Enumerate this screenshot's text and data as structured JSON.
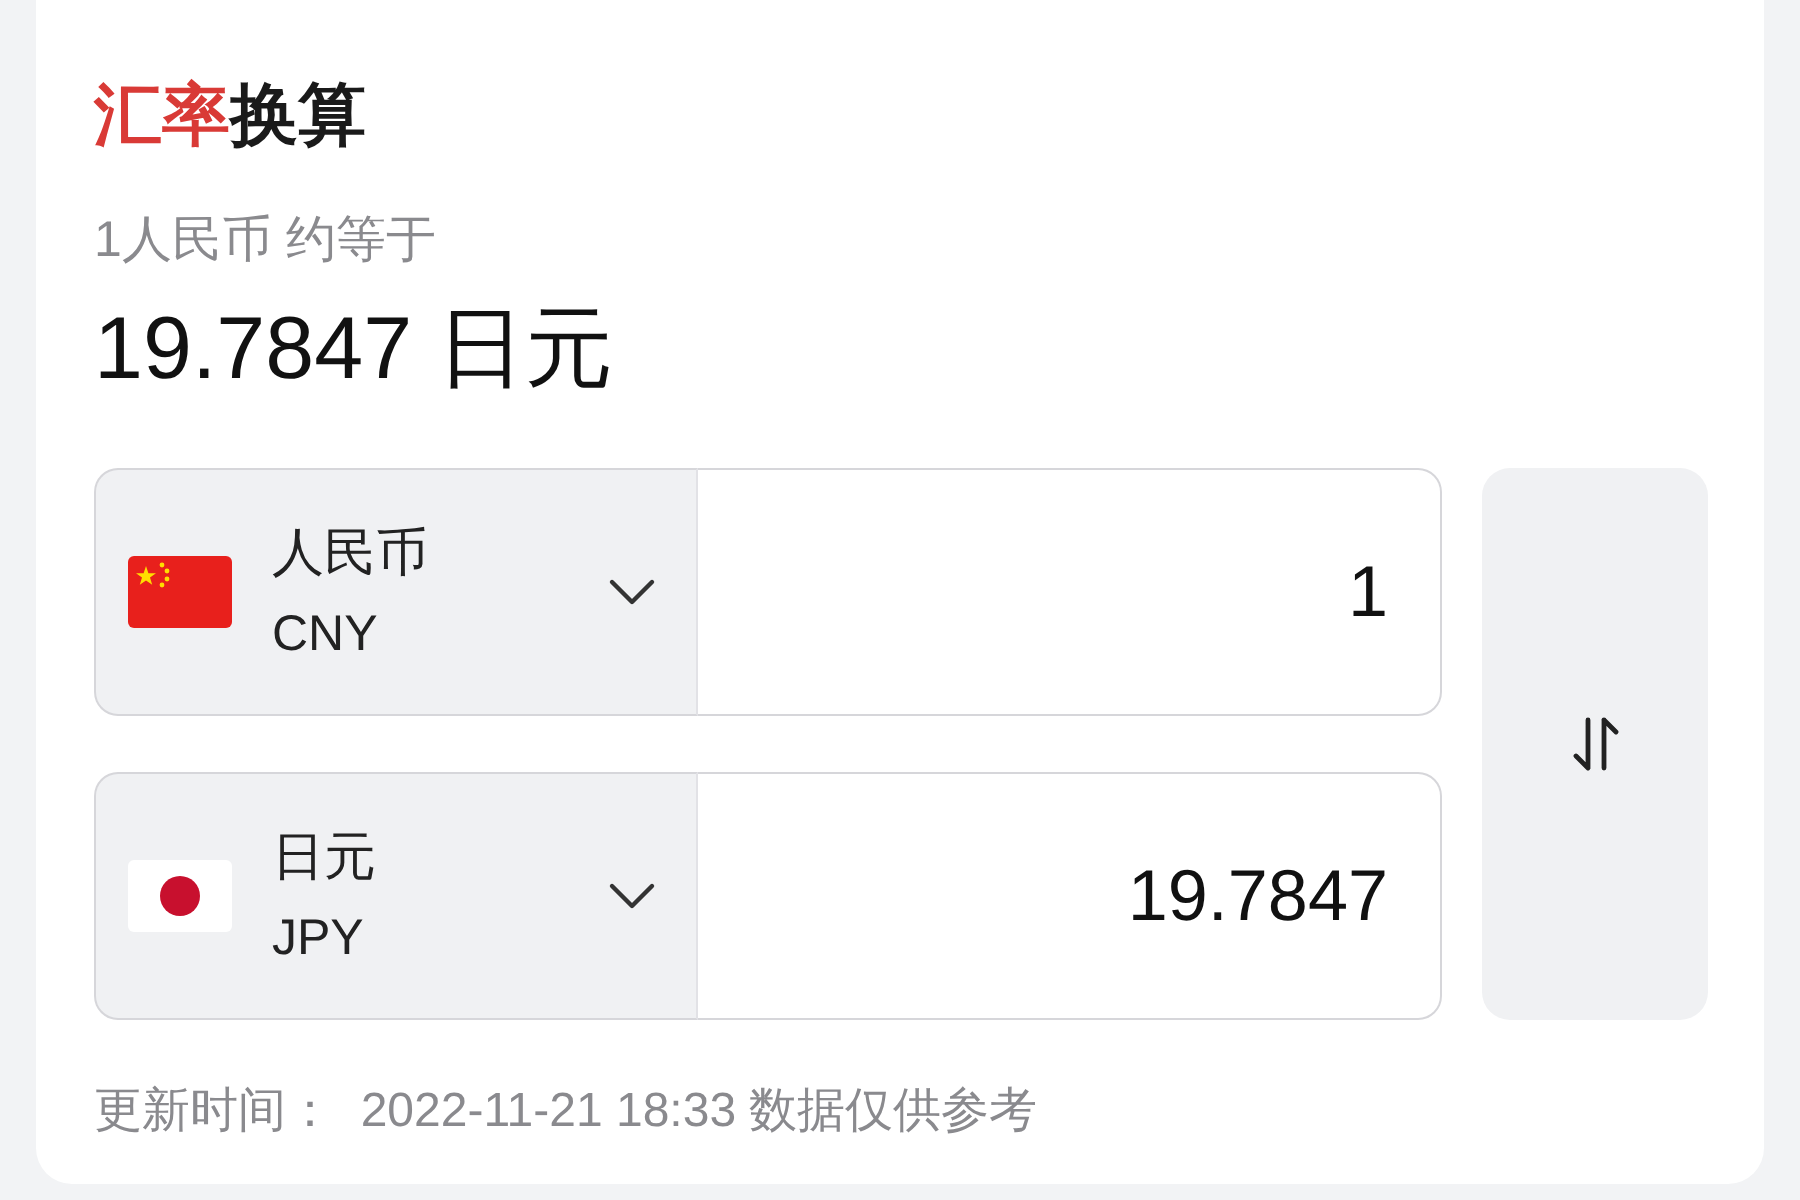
{
  "title": [
    {
      "text": "汇率",
      "kind": "accent"
    },
    {
      "text": "换算",
      "kind": "plain"
    }
  ],
  "rate_caption": "1人民币 约等于",
  "rate_value": "19.7847 日元",
  "converters": [
    {
      "kind": "cn",
      "name": "人民币",
      "code": "CNY",
      "amount": "1"
    },
    {
      "kind": "jp",
      "name": "日元",
      "code": "JPY",
      "amount": "19.7847"
    }
  ],
  "footer": "更新时间：  2022-11-21 18:33 数据仅供参考"
}
